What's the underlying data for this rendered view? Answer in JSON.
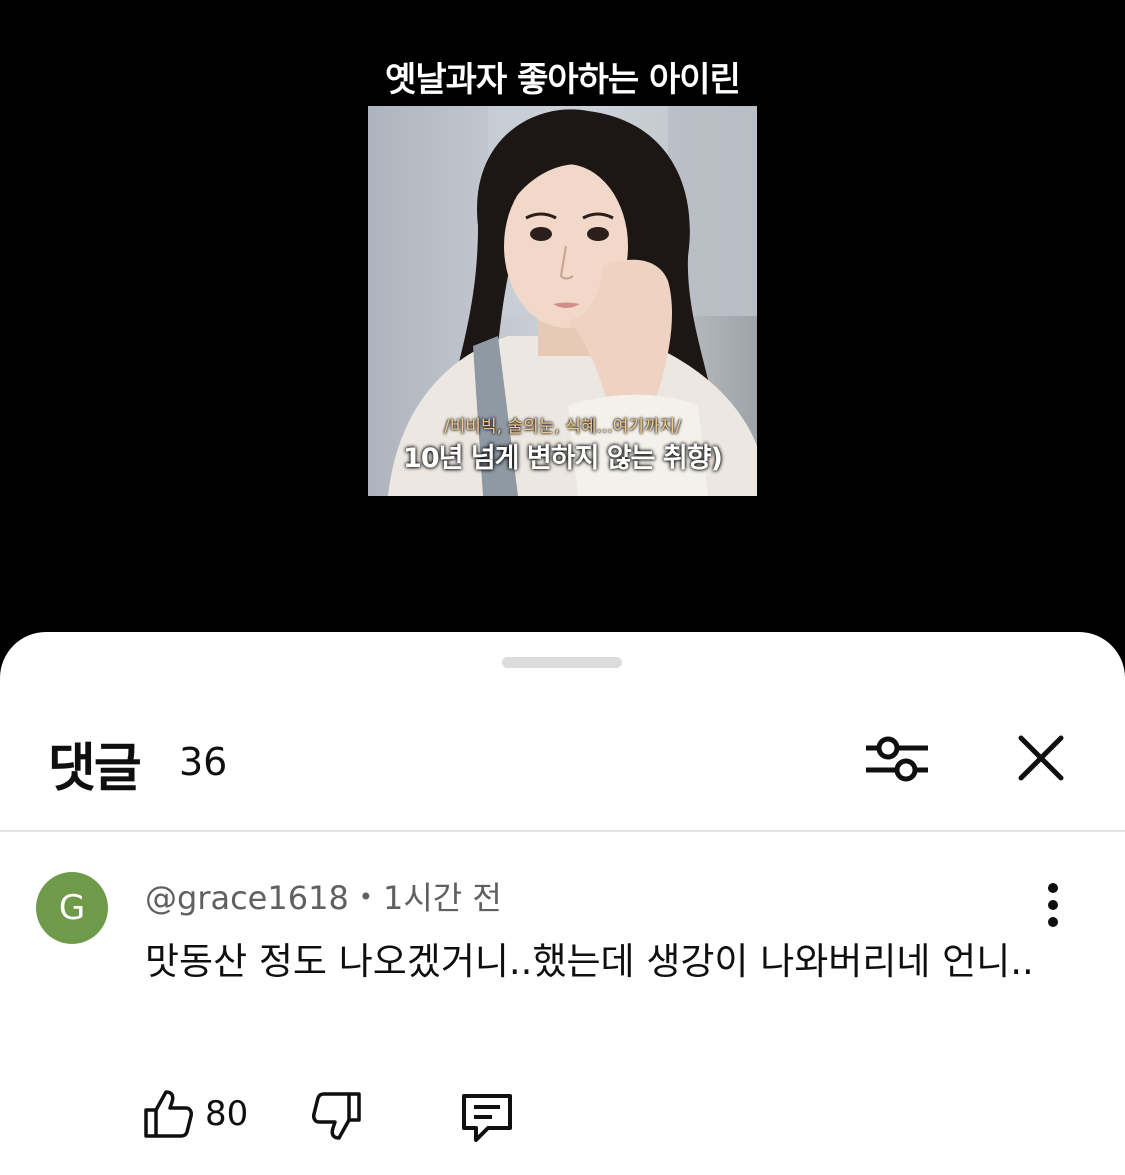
{
  "video": {
    "title": "옛날과자 좋아하는 아이린",
    "caption_small": "/비비빅, 술의눈, 식혜...여기까지/",
    "caption_big": "10년 넘게 변하지 않는 취향)"
  },
  "comments_panel": {
    "title": "댓글",
    "count": "36",
    "filter_icon": "sliders-icon",
    "close_icon": "close-icon"
  },
  "comment": {
    "avatar_letter": "G",
    "avatar_color": "#6f9a4a",
    "author": "@grace1618",
    "separator": "•",
    "time": "1시간 전",
    "text": "맛동산 정도 나오겠거니..했는데 생강이 나와버리네 언니..",
    "likes": "80",
    "more_icon": "more-vertical-icon",
    "like_icon": "thumbs-up-icon",
    "dislike_icon": "thumbs-down-icon",
    "reply_icon": "comment-reply-icon"
  }
}
